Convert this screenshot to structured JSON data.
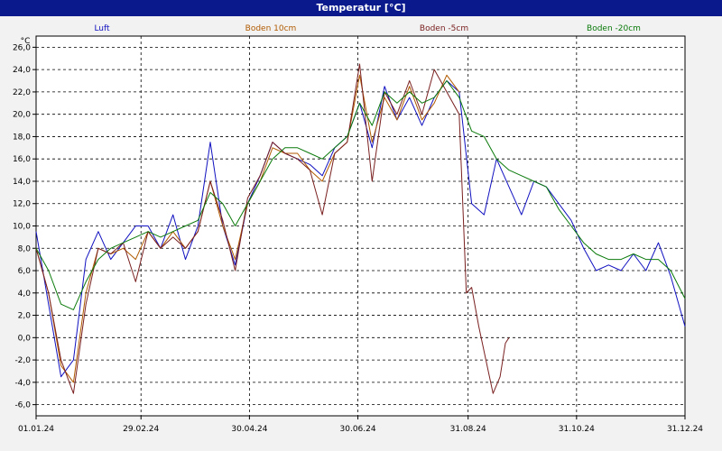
{
  "window": {
    "title": "Temperatur [°C]"
  },
  "chart_data": {
    "type": "line",
    "unit_label": "°C",
    "ylim": [
      -7.0,
      27.0
    ],
    "y_ticks": [
      "26,0",
      "24,0",
      "22,0",
      "20,0",
      "18,0",
      "16,0",
      "14,0",
      "12,0",
      "10,0",
      "8,0",
      "6,0",
      "4,0",
      "2,0",
      "0,0",
      "-2,0",
      "-4,0",
      "-6,0"
    ],
    "x_ticks": [
      "01.01.24",
      "29.02.24",
      "30.04.24",
      "30.06.24",
      "31.08.24",
      "31.10.24",
      "31.12.24"
    ],
    "grid": true,
    "legend_placement": "top",
    "series": [
      {
        "name": "Luft",
        "color": "#1010c0",
        "x": [
          "01.01.24",
          "08.01.24",
          "15.01.24",
          "22.01.24",
          "29.01.24",
          "05.02.24",
          "12.02.24",
          "19.02.24",
          "26.02.24",
          "04.03.24",
          "11.03.24",
          "18.03.24",
          "25.03.24",
          "01.04.24",
          "08.04.24",
          "15.04.24",
          "22.04.24",
          "29.04.24",
          "06.05.24",
          "13.05.24",
          "20.05.24",
          "27.05.24",
          "03.06.24",
          "10.06.24",
          "17.06.24",
          "24.06.24",
          "01.07.24",
          "08.07.24",
          "15.07.24",
          "22.07.24",
          "29.07.24",
          "05.08.24",
          "12.08.24",
          "19.08.24",
          "26.08.24",
          "02.09.24",
          "09.09.24",
          "16.09.24",
          "23.09.24",
          "30.09.24",
          "07.10.24",
          "14.10.24",
          "21.10.24",
          "28.10.24",
          "04.11.24",
          "11.11.24",
          "18.11.24",
          "25.11.24",
          "02.12.24",
          "09.12.24",
          "16.12.24",
          "23.12.24",
          "31.12.24"
        ],
        "y": [
          9.5,
          3.0,
          -3.5,
          -2.0,
          7.0,
          9.5,
          7.0,
          8.5,
          10.0,
          10.0,
          8.0,
          11.0,
          7.0,
          10.0,
          17.5,
          10.0,
          6.5,
          12.0,
          14.5,
          17.5,
          16.5,
          16.0,
          15.5,
          14.5,
          17.0,
          18.0,
          21.0,
          17.0,
          22.5,
          19.5,
          21.5,
          19.0,
          21.5,
          23.0,
          22.0,
          12.0,
          11.0,
          16.0,
          13.5,
          11.0,
          14.0,
          13.5,
          12.0,
          10.5,
          8.0,
          6.0,
          6.5,
          6.0,
          7.5,
          6.0,
          8.5,
          5.5,
          1.0
        ]
      },
      {
        "name": "Boden 10cm",
        "color": "#b05a00",
        "x": [
          "01.01.24",
          "08.01.24",
          "15.01.24",
          "22.01.24",
          "29.01.24",
          "05.02.24",
          "12.02.24",
          "19.02.24",
          "26.02.24",
          "04.03.24",
          "11.03.24",
          "18.03.24",
          "25.03.24",
          "01.04.24",
          "08.04.24",
          "15.04.24",
          "22.04.24",
          "29.04.24",
          "06.05.24",
          "13.05.24",
          "20.05.24",
          "27.05.24",
          "03.06.24",
          "10.06.24",
          "17.06.24",
          "24.06.24",
          "01.07.24",
          "08.07.24",
          "15.07.24",
          "22.07.24",
          "29.07.24",
          "05.08.24",
          "12.08.24",
          "19.08.24",
          "26.08.24"
        ],
        "y": [
          8.0,
          4.0,
          -2.5,
          -4.0,
          4.0,
          8.0,
          7.5,
          8.0,
          7.0,
          9.5,
          8.0,
          9.5,
          8.0,
          9.5,
          14.0,
          10.0,
          7.0,
          12.0,
          14.0,
          17.0,
          16.5,
          16.5,
          15.0,
          14.0,
          16.5,
          17.5,
          23.5,
          17.5,
          21.5,
          19.5,
          22.5,
          19.5,
          21.0,
          23.5,
          22.0
        ]
      },
      {
        "name": "Boden -5cm",
        "color": "#7a2020",
        "x": [
          "01.01.24",
          "08.01.24",
          "15.01.24",
          "22.01.24",
          "29.01.24",
          "05.02.24",
          "12.02.24",
          "19.02.24",
          "26.02.24",
          "04.03.24",
          "11.03.24",
          "18.03.24",
          "25.03.24",
          "01.04.24",
          "08.04.24",
          "15.04.24",
          "22.04.24",
          "29.04.24",
          "06.05.24",
          "13.05.24",
          "20.05.24",
          "27.05.24",
          "03.06.24",
          "10.06.24",
          "17.06.24",
          "24.06.24",
          "01.07.24",
          "08.07.24",
          "15.07.24",
          "22.07.24",
          "29.07.24",
          "05.08.24",
          "12.08.24",
          "19.08.24",
          "26.08.24",
          "30.08.24",
          "02.09.24",
          "06.09.24",
          "10.09.24",
          "14.09.24",
          "18.09.24",
          "21.09.24",
          "23.09.24"
        ],
        "y": [
          8.0,
          4.0,
          -2.0,
          -5.0,
          3.0,
          8.0,
          7.5,
          8.5,
          5.0,
          9.5,
          8.0,
          9.0,
          8.0,
          9.5,
          14.0,
          10.5,
          6.0,
          12.5,
          14.5,
          17.5,
          16.5,
          16.0,
          15.0,
          11.0,
          16.5,
          17.5,
          24.5,
          14.0,
          22.0,
          20.0,
          23.0,
          20.0,
          24.0,
          22.0,
          20.0,
          4.0,
          4.5,
          1.0,
          -2.0,
          -5.0,
          -3.5,
          -0.5,
          0.0
        ]
      },
      {
        "name": "Boden -20cm",
        "color": "#0a7a0a",
        "x": [
          "01.01.24",
          "08.01.24",
          "15.01.24",
          "22.01.24",
          "29.01.24",
          "05.02.24",
          "12.02.24",
          "19.02.24",
          "26.02.24",
          "04.03.24",
          "11.03.24",
          "18.03.24",
          "25.03.24",
          "01.04.24",
          "08.04.24",
          "15.04.24",
          "22.04.24",
          "29.04.24",
          "06.05.24",
          "13.05.24",
          "20.05.24",
          "27.05.24",
          "03.06.24",
          "10.06.24",
          "17.06.24",
          "24.06.24",
          "01.07.24",
          "08.07.24",
          "15.07.24",
          "22.07.24",
          "29.07.24",
          "05.08.24",
          "12.08.24",
          "19.08.24",
          "26.08.24",
          "02.09.24",
          "09.09.24",
          "16.09.24",
          "23.09.24",
          "30.09.24",
          "07.10.24",
          "14.10.24",
          "21.10.24",
          "28.10.24",
          "04.11.24",
          "11.11.24",
          "18.11.24",
          "25.11.24",
          "02.12.24",
          "09.12.24",
          "16.12.24",
          "23.12.24",
          "31.12.24"
        ],
        "y": [
          8.0,
          6.0,
          3.0,
          2.5,
          5.0,
          7.0,
          8.0,
          8.5,
          9.0,
          9.5,
          9.0,
          9.5,
          10.0,
          10.5,
          13.0,
          12.0,
          10.0,
          12.0,
          14.0,
          16.0,
          17.0,
          17.0,
          16.5,
          16.0,
          17.0,
          18.0,
          21.0,
          19.0,
          22.0,
          21.0,
          22.0,
          21.0,
          21.5,
          23.0,
          21.5,
          18.5,
          18.0,
          16.0,
          15.0,
          14.5,
          14.0,
          13.5,
          11.5,
          10.0,
          8.5,
          7.5,
          7.0,
          7.0,
          7.5,
          7.0,
          7.0,
          6.0,
          3.5
        ]
      }
    ]
  }
}
